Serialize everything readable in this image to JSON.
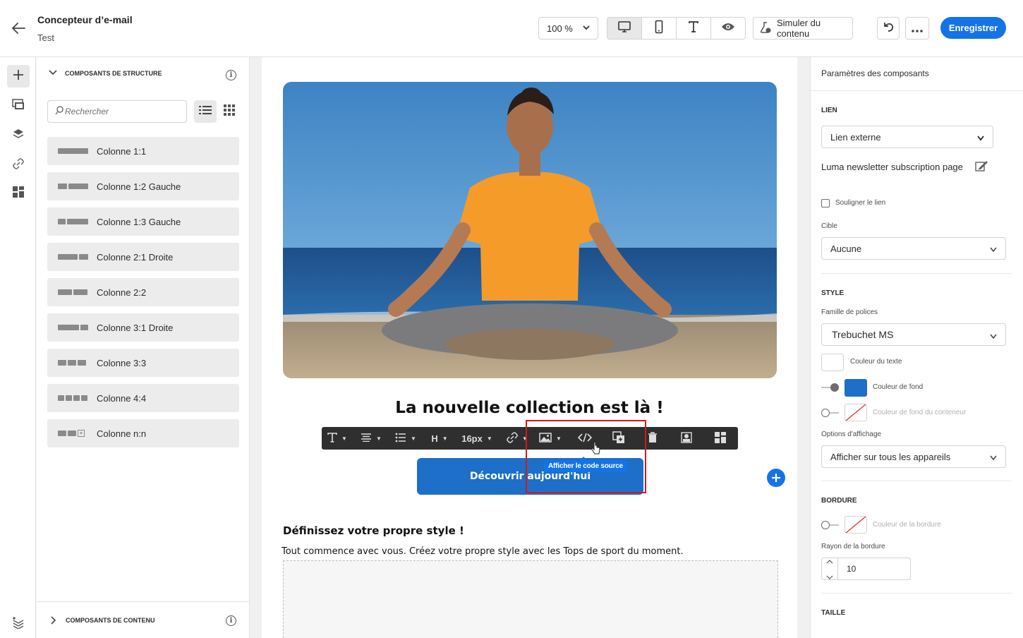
{
  "header": {
    "title": "Concepteur d’e-mail",
    "subtitle": "Test",
    "zoom": "100 %",
    "simulate_label": "Simuler du contenu",
    "save_label": "Enregistrer"
  },
  "structure_panel": {
    "heading": "COMPOSANTS DE STRUCTURE",
    "search_placeholder": "Rechercher",
    "items": [
      {
        "label": "Colonne 1:1"
      },
      {
        "label": "Colonne 1:2 Gauche"
      },
      {
        "label": "Colonne 1:3 Gauche"
      },
      {
        "label": "Colonne 2:1 Droite"
      },
      {
        "label": "Colonne 2:2"
      },
      {
        "label": "Colonne 3:1 Droite"
      },
      {
        "label": "Colonne 3:3"
      },
      {
        "label": "Colonne 4:4"
      },
      {
        "label": "Colonne n:n"
      }
    ],
    "content_heading": "COMPOSANTS DE CONTENU"
  },
  "canvas": {
    "headline": "La nouvelle collection est là !",
    "toolbar": {
      "font_size": "16px"
    },
    "cta_label": "Découvrir aujourd'hui",
    "tooltip": "Afficher le code source",
    "section_title": "Définissez votre propre style !",
    "section_body": "Tout commence avec vous. Créez votre propre style avec les Tops de sport du moment."
  },
  "settings": {
    "heading": "Paramètres des composants",
    "link_section": "LIEN",
    "link_type": "Lien externe",
    "link_value": "Luma newsletter subscription page",
    "underline_label": "Souligner le lien",
    "target_label": "Cible",
    "target_value": "Aucune",
    "style_section": "STYLE",
    "font_family_label": "Famille de polices",
    "font_family_value": "Trebuchet MS",
    "text_color_label": "Couleur du texte",
    "bg_color_label": "Couleur de fond",
    "container_bg_label": "Couleur de fond du conteneur",
    "display_options_label": "Options d'affichage",
    "display_options_value": "Afficher sur tous les appareils",
    "border_section": "BORDURE",
    "border_color_label": "Couleur de la bordure",
    "border_radius_label": "Rayon de la bordure",
    "border_radius_value": "10",
    "size_section": "TAILLE"
  },
  "colors": {
    "accent": "#1473e6",
    "button_bg": "#1d6fc7",
    "highlight": "#d11a1a"
  }
}
